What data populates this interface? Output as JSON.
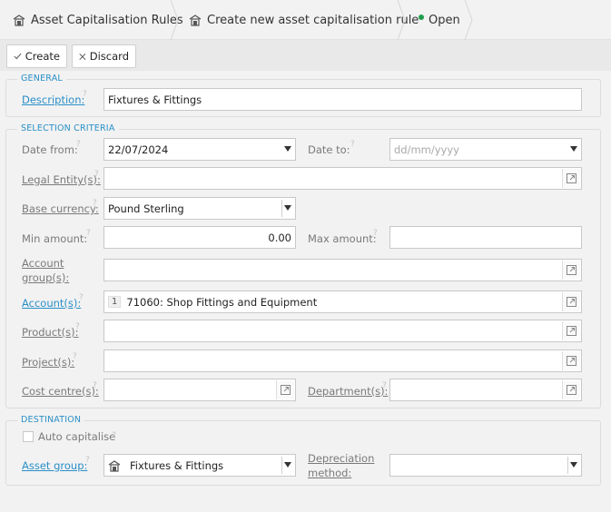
{
  "breadcrumb": {
    "items": [
      {
        "label": "Asset Capitalisation Rules"
      },
      {
        "label": "Create new asset capitalisation rule"
      },
      {
        "label": "Open"
      }
    ]
  },
  "toolbar": {
    "create_label": "Create",
    "discard_label": "Discard"
  },
  "general": {
    "title": "GENERAL",
    "description_label": "Description:",
    "description_value": "Fixtures & Fittings"
  },
  "criteria": {
    "title": "SELECTION CRITERIA",
    "date_from_label": "Date from:",
    "date_from_value": "22/07/2024",
    "date_to_label": "Date to:",
    "date_to_placeholder": "dd/mm/yyyy",
    "legal_entity_label": "Legal Entity(s):",
    "base_currency_label": "Base currency:",
    "base_currency_value": "Pound Sterling",
    "min_amount_label": "Min amount:",
    "min_amount_value": "0.00",
    "max_amount_label": "Max amount:",
    "account_group_label_1": "Account",
    "account_group_label_2": "group(s):",
    "accounts_label": "Account(s):",
    "accounts_count": "1",
    "accounts_value": "71060: Shop Fittings and Equipment",
    "products_label": "Product(s):",
    "projects_label": "Project(s):",
    "cost_centres_label": "Cost centre(s):",
    "departments_label": "Department(s):"
  },
  "destination": {
    "title": "DESTINATION",
    "auto_capitalise_label": "Auto capitalise",
    "asset_group_label": "Asset group:",
    "asset_group_value": "Fixtures & Fittings",
    "depreciation_label_1": "Depreciation",
    "depreciation_label_2": "method:"
  },
  "help_mark": "?",
  "colors": {
    "accent": "#2a8fc8",
    "status_open": "#1e9e4a",
    "background": "#f2f2f2"
  },
  "icons": {
    "breadcrumb_icon": "building-icon",
    "lookup_icon": "popout-icon",
    "create_icon": "check-icon",
    "discard_icon": "close-icon"
  }
}
